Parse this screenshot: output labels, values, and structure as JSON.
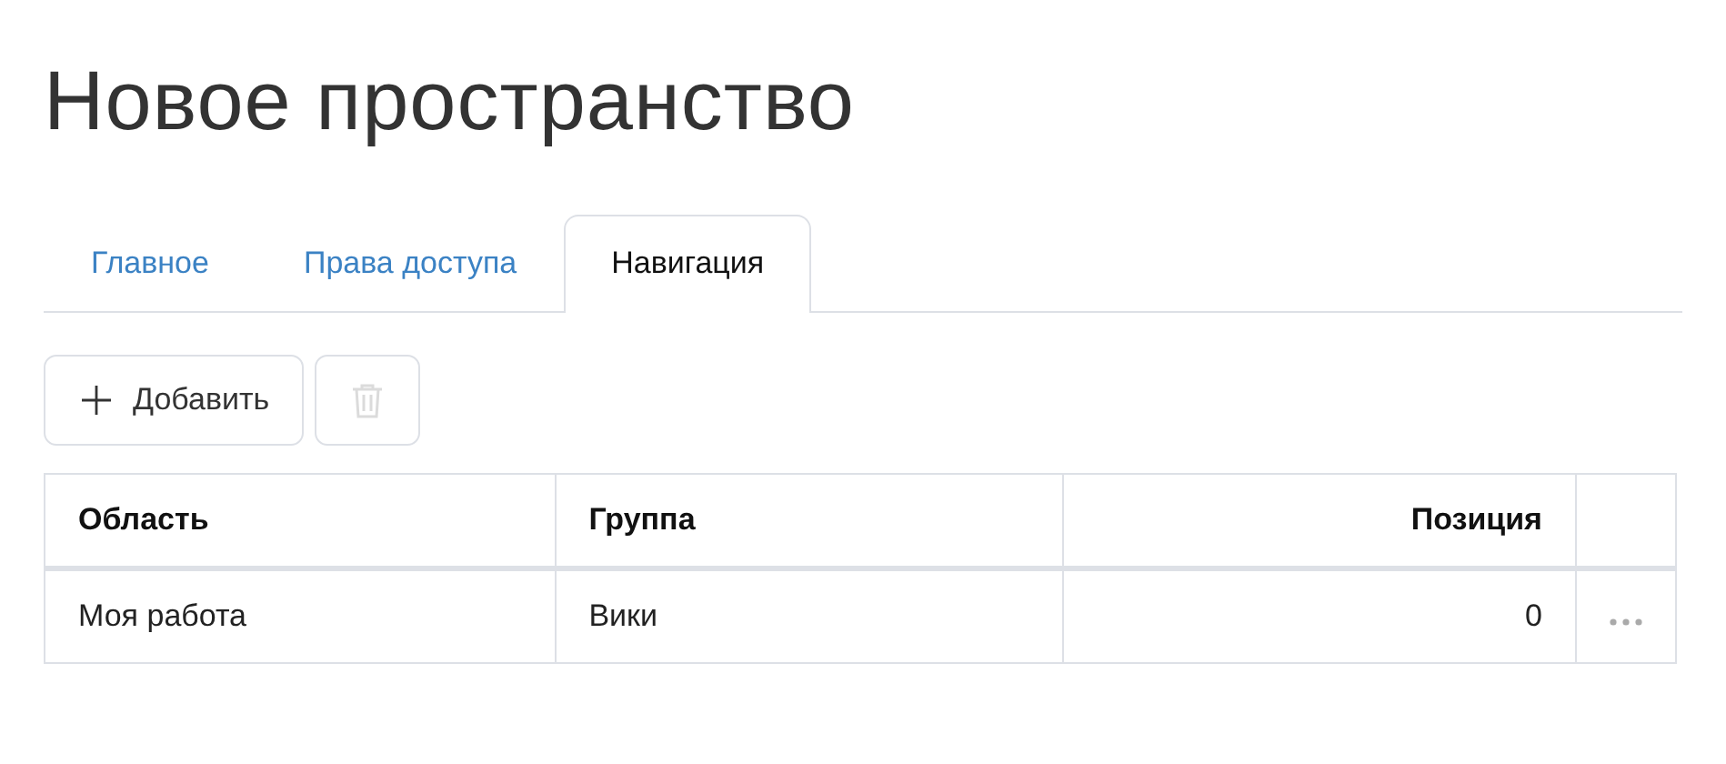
{
  "title": "Новое пространство",
  "tabs": [
    {
      "label": "Главное",
      "selected": false
    },
    {
      "label": "Права доступа",
      "selected": false
    },
    {
      "label": "Навигация",
      "selected": true
    }
  ],
  "toolbar": {
    "add_button": {
      "label": "Добавить"
    },
    "delete_button": {
      "disabled": true
    }
  },
  "table": {
    "columns": [
      {
        "label": "Область",
        "kind": "text"
      },
      {
        "label": "Группа",
        "kind": "text"
      },
      {
        "label": "Позиция",
        "kind": "number"
      }
    ],
    "rows": [
      {
        "cells": [
          "Моя работа",
          "Вики",
          "0"
        ]
      }
    ]
  }
}
